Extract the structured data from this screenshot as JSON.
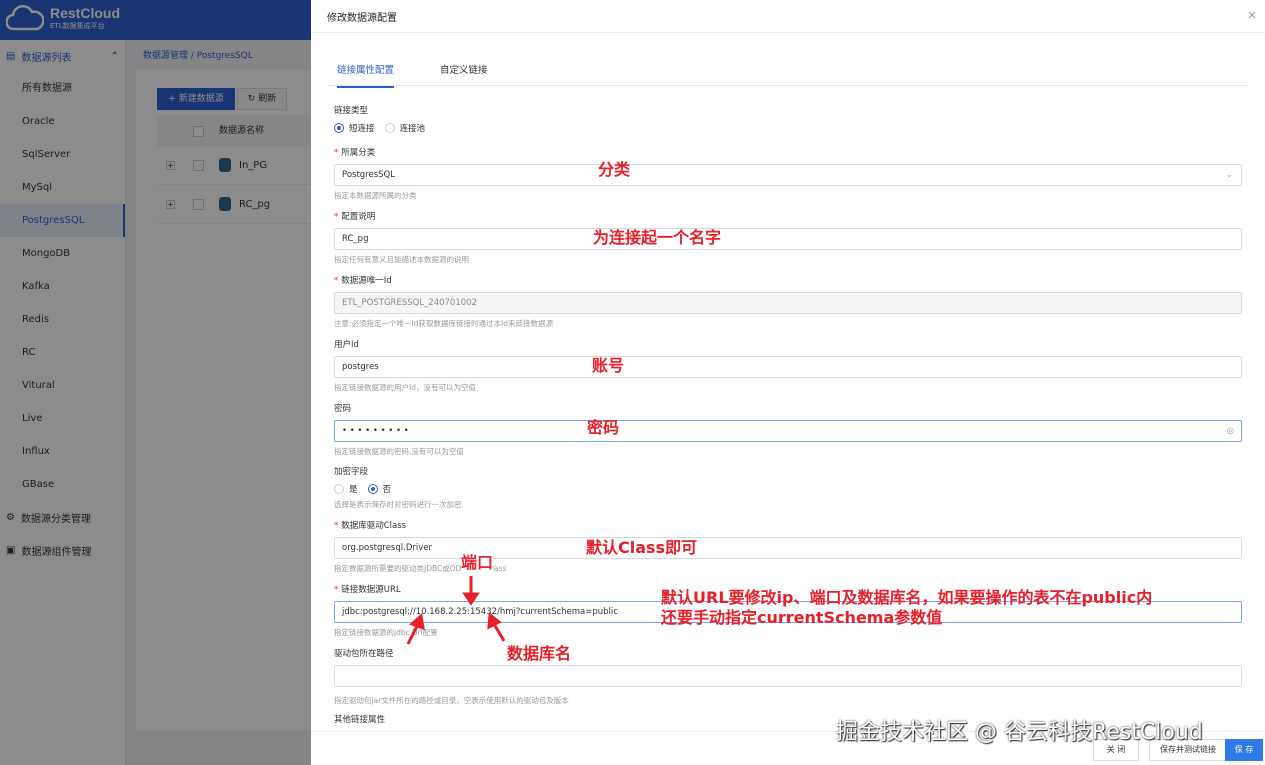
{
  "app": {
    "logo_title": "RestCloud",
    "logo_subtitle": "ETL数据集成平台"
  },
  "sidebar": {
    "group": "数据源列表",
    "items": [
      "所有数据源",
      "Oracle",
      "SqlServer",
      "MySql",
      "PostgresSQL",
      "MongoDB",
      "Kafka",
      "Redis",
      "RC",
      "Vitural",
      "Live",
      "Influx",
      "GBase"
    ],
    "active": "PostgresSQL",
    "extra": [
      "数据源分类管理",
      "数据源组件管理"
    ]
  },
  "main": {
    "breadcrumb": "数据源管理 / PostgresSQL",
    "new_button": "+ 新建数据源",
    "refresh_button": "刷新",
    "column": "数据源名称",
    "rows": [
      "In_PG",
      "RC_pg"
    ]
  },
  "drawer": {
    "title": "修改数据源配置",
    "close": "×",
    "tabs": [
      "链接属性配置",
      "自定义链接"
    ],
    "conn_type": {
      "label": "链接类型",
      "options": [
        "短连接",
        "连接池"
      ],
      "selected": "短连接"
    },
    "category": {
      "label": "所属分类",
      "value": "PostgresSQL",
      "hint": "指定本数据源所属的分类"
    },
    "desc": {
      "label": "配置说明",
      "value": "RC_pg",
      "hint": "指定任何有意义且能描述本数据源的说明"
    },
    "uid": {
      "label": "数据源唯一Id",
      "value": "ETL_POSTGRESSQL_240701002",
      "hint": "注意:必须指定一个唯一Id获取数据库链接时通过本Id来链接数据源"
    },
    "user": {
      "label": "用户Id",
      "value": "postgres",
      "hint": "指定链接数据源的用户Id，没有可以为空值"
    },
    "password": {
      "label": "密码",
      "value": "• • • • • • • • •",
      "hint": "指定链接数据源的密码,没有可以为空值"
    },
    "encrypt": {
      "label": "加密字段",
      "options": [
        "是",
        "否"
      ],
      "selected": "否",
      "hint": "选择是表示保存时对密码进行一次加密"
    },
    "driver": {
      "label": "数据库驱动Class",
      "value": "org.postgresql.Driver",
      "hint": "指定数据源所需要的驱动类JDBC或ODBC驱动Class"
    },
    "url": {
      "label": "链接数据源URL",
      "value": "jdbc:postgresql://10.168.2.25:15432/hmj?currentSchema=public",
      "hint": "指定链接数据源的jdbc Url配置"
    },
    "jar": {
      "label": "驱动包所在路径",
      "value": "",
      "hint": "指定驱动包jar文件所在的路径或目录，空表示使用默认的驱动包及版本"
    },
    "other": {
      "label": "其他链接属性"
    },
    "footer": {
      "close": "关 闭",
      "save_test": "保存并测试链接",
      "save": "保 存"
    }
  },
  "annotations": {
    "category": "分类",
    "desc": "为连接起一个名字",
    "user": "账号",
    "password": "密码",
    "driver": "默认Class即可",
    "port": "端口",
    "dbname": "数据库名",
    "url_note_1": "默认URL要修改ip、端口及数据库名，如果要操作的表不在public内",
    "url_note_2": "还要手动指定currentSchema参数值"
  },
  "watermark": "掘金技术社区 @ 谷云科技RestCloud"
}
